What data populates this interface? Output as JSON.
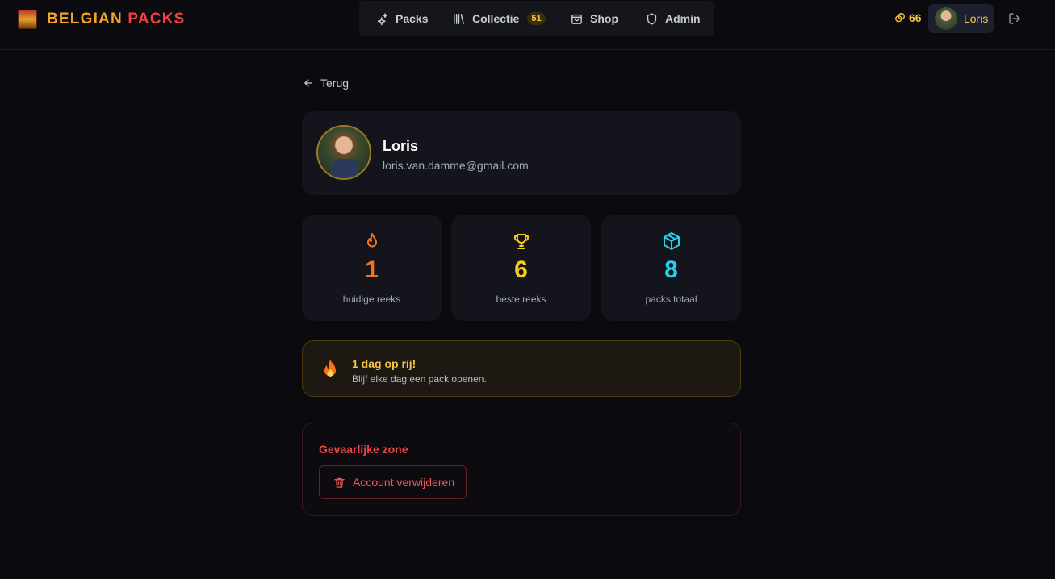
{
  "brand": {
    "word1": "BELGIAN",
    "word2": "PACKS"
  },
  "nav": {
    "packs": "Packs",
    "collectie": "Collectie",
    "collectie_badge": "51",
    "shop": "Shop",
    "admin": "Admin"
  },
  "account": {
    "coins": "66",
    "username": "Loris"
  },
  "back_label": "Terug",
  "profile": {
    "name": "Loris",
    "email": "loris.van.damme@gmail.com"
  },
  "stats": [
    {
      "value": "1",
      "label": "huidige reeks",
      "color": "#f97316",
      "icon": "flame-icon"
    },
    {
      "value": "6",
      "label": "beste reeks",
      "color": "#facc15",
      "icon": "trophy-icon"
    },
    {
      "value": "8",
      "label": "packs totaal",
      "color": "#22d3ee",
      "icon": "box-icon"
    }
  ],
  "streak": {
    "title": "1 dag op rij!",
    "subtitle": "Blijf elke dag een pack openen."
  },
  "danger": {
    "title": "Gevaarlijke zone",
    "delete_label": "Account verwijderen"
  }
}
